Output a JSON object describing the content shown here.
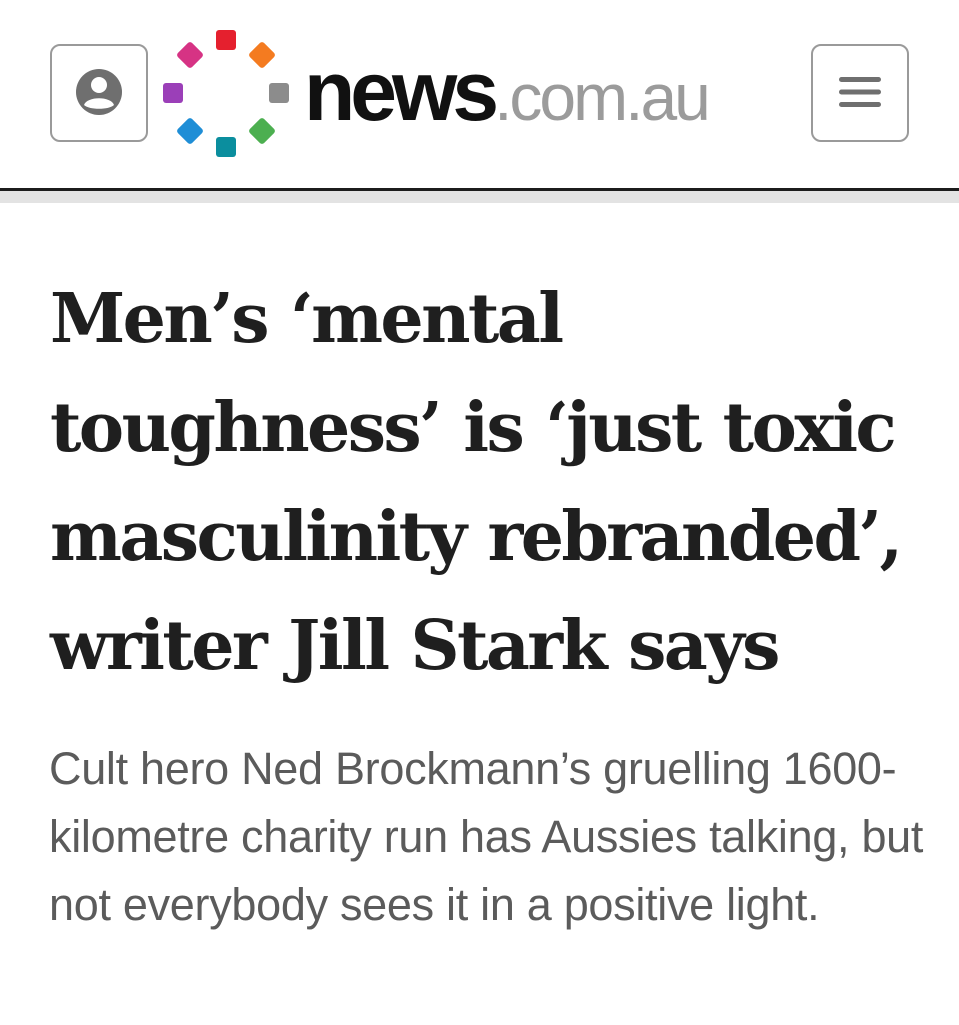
{
  "header": {
    "logo": {
      "primary": "news",
      "secondary": ".com.au",
      "mark_colors": [
        "#e5202e",
        "#f47b20",
        "#8c8c8c",
        "#4caf50",
        "#0b8e9e",
        "#1f8ed6",
        "#9b3fb8",
        "#d63384"
      ]
    },
    "account_button": {
      "icon": "user-circle-icon"
    },
    "menu_button": {
      "icon": "hamburger-menu-icon"
    }
  },
  "article": {
    "headline": "Men’s ‘mental toughness’ is ‘just toxic masculinity rebranded’, writer Jill Stark says",
    "standfirst": "Cult hero Ned Brockmann’s gruelling 1600-kilometre charity run has Aussies talking, but not everybody sees it in a positive light."
  },
  "colors": {
    "headline_text": "#1f1f1f",
    "standfirst_text": "#5b5b5b",
    "header_rule": "#1c1c1c",
    "header_rule_shadow": "#e3e3e3",
    "button_border": "#9a9a9a",
    "icon_gray": "#6f6f6f"
  }
}
